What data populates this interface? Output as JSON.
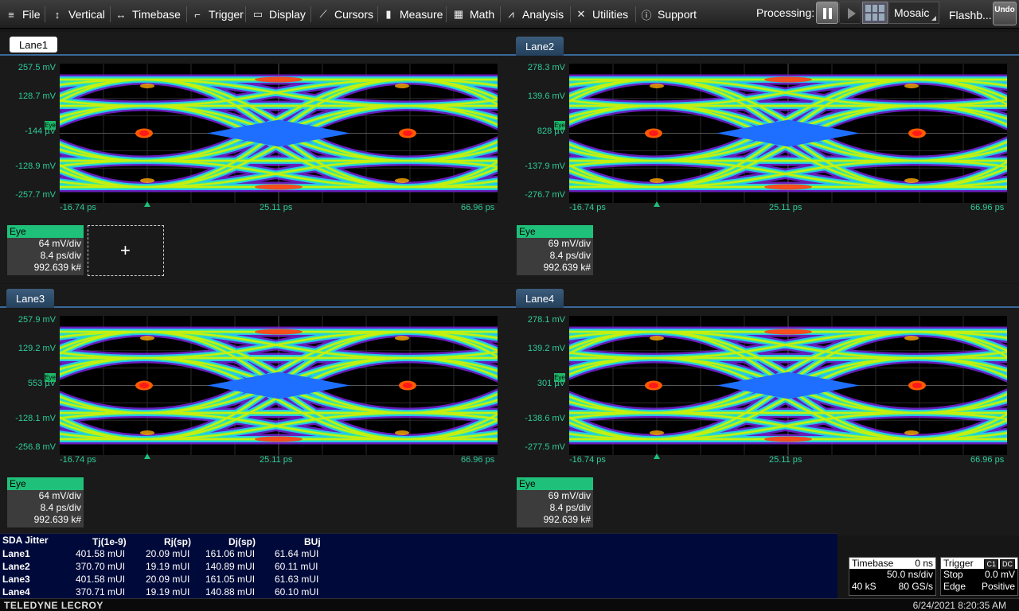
{
  "menu": [
    {
      "label": "File",
      "icon": "file-icon",
      "glyph": "≡"
    },
    {
      "label": "Vertical",
      "icon": "vertical-icon",
      "glyph": "↕"
    },
    {
      "label": "Timebase",
      "icon": "timebase-icon",
      "glyph": "↔"
    },
    {
      "label": "Trigger",
      "icon": "trigger-icon",
      "glyph": "⌐"
    },
    {
      "label": "Display",
      "icon": "display-icon",
      "glyph": "▭"
    },
    {
      "label": "Cursors",
      "icon": "cursors-icon",
      "glyph": "⟋"
    },
    {
      "label": "Measure",
      "icon": "measure-icon",
      "glyph": "▮"
    },
    {
      "label": "Math",
      "icon": "math-icon",
      "glyph": "▦"
    },
    {
      "label": "Analysis",
      "icon": "analysis-icon",
      "glyph": "⩘"
    },
    {
      "label": "Utilities",
      "icon": "utilities-icon",
      "glyph": "✕"
    },
    {
      "label": "Support",
      "icon": "support-icon",
      "glyph": "ⓘ"
    }
  ],
  "toolbar": {
    "processing_label": "Processing:",
    "mosaic_label": "Mosaic",
    "flashback_label": "Flashb...",
    "undo_label": "Undo"
  },
  "lanes": [
    {
      "name": "Lane1",
      "y_top": "257.5 mV",
      "y_upper": "128.7 mV",
      "y_center": "-144 µV",
      "y_lower": "-128.9 mV",
      "y_bottom": "-257.7 mV",
      "x_left": "-16.74 ps",
      "x_mid": "25.11 ps",
      "x_right": "66.96 ps",
      "tag": "Eye",
      "desc": {
        "title": "Eye",
        "vdiv": "64 mV/div",
        "hdiv": "8.4 ps/div",
        "count": "992.639 k#"
      }
    },
    {
      "name": "Lane2",
      "y_top": "278.3 mV",
      "y_upper": "139.6 mV",
      "y_center": "828 µV",
      "y_lower": "-137.9 mV",
      "y_bottom": "-276.7 mV",
      "x_left": "-16.74 ps",
      "x_mid": "25.11 ps",
      "x_right": "66.96 ps",
      "tag": "Eye",
      "desc": {
        "title": "Eye",
        "vdiv": "69 mV/div",
        "hdiv": "8.4 ps/div",
        "count": "992.639 k#"
      }
    },
    {
      "name": "Lane3",
      "y_top": "257.9 mV",
      "y_upper": "129.2 mV",
      "y_center": "553 µV",
      "y_lower": "-128.1 mV",
      "y_bottom": "-256.8 mV",
      "x_left": "-16.74 ps",
      "x_mid": "25.11 ps",
      "x_right": "66.96 ps",
      "tag": "Eye",
      "desc": {
        "title": "Eye",
        "vdiv": "64 mV/div",
        "hdiv": "8.4 ps/div",
        "count": "992.639 k#"
      }
    },
    {
      "name": "Lane4",
      "y_top": "278.1 mV",
      "y_upper": "139.2 mV",
      "y_center": "301 µV",
      "y_lower": "-138.6 mV",
      "y_bottom": "-277.5 mV",
      "x_left": "-16.74 ps",
      "x_mid": "25.11 ps",
      "x_right": "66.96 ps",
      "tag": "Eye",
      "desc": {
        "title": "Eye",
        "vdiv": "69 mV/div",
        "hdiv": "8.4 ps/div",
        "count": "992.639 k#"
      }
    }
  ],
  "add_plus": "+",
  "sda": {
    "title": "SDA Jitter",
    "headers": [
      "Tj(1e-9)",
      "Rj(sp)",
      "Dj(sp)",
      "BUj"
    ],
    "rows": [
      {
        "lane": "Lane1",
        "tj": "401.58 mUI",
        "rj": "20.09 mUI",
        "dj": "161.06 mUI",
        "buj": "61.64 mUI"
      },
      {
        "lane": "Lane2",
        "tj": "370.70 mUI",
        "rj": "19.19 mUI",
        "dj": "140.89 mUI",
        "buj": "60.11 mUI"
      },
      {
        "lane": "Lane3",
        "tj": "401.58 mUI",
        "rj": "20.09 mUI",
        "dj": "161.05 mUI",
        "buj": "61.63 mUI"
      },
      {
        "lane": "Lane4",
        "tj": "370.71 mUI",
        "rj": "19.19 mUI",
        "dj": "140.88 mUI",
        "buj": "60.10 mUI"
      }
    ]
  },
  "timebase": {
    "label": "Timebase",
    "delay": "0 ns",
    "per_div": "50.0 ns/div",
    "samples": "40 kS",
    "rate": "80 GS/s"
  },
  "trigger": {
    "label": "Trigger",
    "badge1": "C1",
    "badge2": "DC",
    "mode": "Stop",
    "level": "0.0 mV",
    "type": "Edge",
    "slope": "Positive"
  },
  "status": {
    "brand": "TELEDYNE LECROY",
    "datetime": "6/24/2021 8:20:35 AM"
  }
}
